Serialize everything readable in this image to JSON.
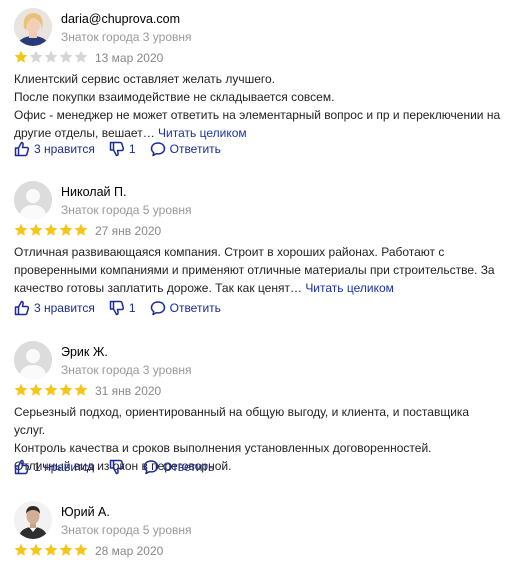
{
  "reviews": [
    {
      "author": "daria@chuprova.com",
      "level": "Знаток города 3 уровня",
      "rating": 1,
      "date": "13 мар 2020",
      "lines": [
        "Клиентский сервис оставляет желать лучшего.",
        "После покупки взаимодействие не складывается совсем.",
        "Офис - менеджер не может ответить на элементарный вопрос и пр и переключении на другие отделы, вешает…"
      ],
      "read_more": "Читать целиком",
      "likes": "3 нравится",
      "dislikes": "1",
      "reply": "Ответить",
      "avatar": "woman-photo"
    },
    {
      "author": "Николай П.",
      "level": "Знаток города 5 уровня",
      "rating": 5,
      "date": "27 янв 2020",
      "lines": [
        "Отличная развивающаяся компания. Строит в хороших районах. Работают с проверенными компаниями и применяют отличные материалы при строительстве. За качество готовы заплатить дороже. Так как ценят…"
      ],
      "read_more": "Читать целиком",
      "likes": "3 нравится",
      "dislikes": "1",
      "reply": "Ответить",
      "avatar": "default-user"
    },
    {
      "author": "Эрик Ж.",
      "level": "Знаток города 3 уровня",
      "rating": 5,
      "date": "31 янв 2020",
      "lines": [
        "Серьезный подход, ориентированный на общую выгоду, и клиента, и поставщика услуг.",
        "Контроль качества и сроков выполнения установленных договоренностей.",
        "Отличный вид из окон в переговорной."
      ],
      "read_more": "",
      "likes": "1 нравится",
      "dislikes": "",
      "reply": "Ответить",
      "avatar": "default-user"
    },
    {
      "author": "Юрий А.",
      "level": "Знаток города 5 уровня",
      "rating": 5,
      "date": "28 мар 2020",
      "lines": [],
      "read_more": "",
      "likes": "",
      "dislikes": "",
      "reply": "",
      "avatar": "man-photo"
    }
  ],
  "colors": {
    "star_filled": "#f5c518",
    "star_empty": "#d6d6d6",
    "link": "#1a33a6",
    "muted": "#999999"
  }
}
